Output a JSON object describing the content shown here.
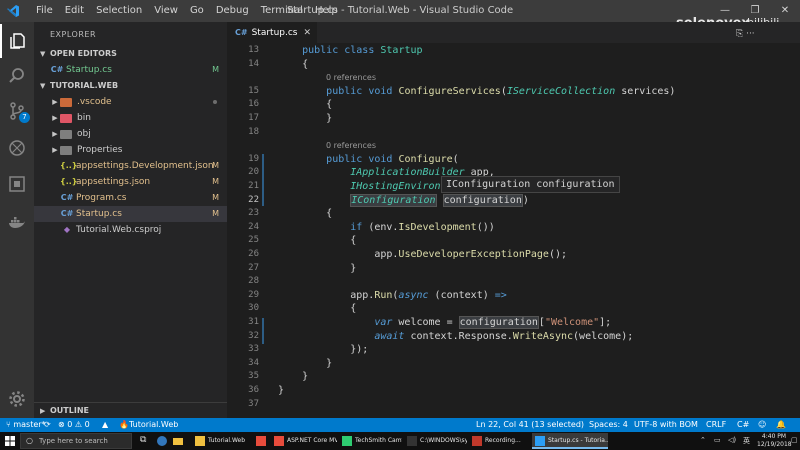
{
  "titlebar": {
    "menu": [
      "File",
      "Edit",
      "Selection",
      "View",
      "Go",
      "Debug",
      "Terminal",
      "Help"
    ],
    "window_title": "Startup.cs - Tutorial.Web - Visual Studio Code",
    "controls": [
      "—",
      "❐",
      "✕"
    ]
  },
  "watermark": {
    "text": "solenovex",
    "sub": "bilibili"
  },
  "activitybar": {
    "icons": [
      "files-icon",
      "search-icon",
      "source-control-icon",
      "debug-icon",
      "extensions-icon",
      "docker-icon",
      "settings-gear-icon"
    ],
    "scm_badge": "7"
  },
  "sidebar": {
    "title": "EXPLORER",
    "open_editors_header": "OPEN EDITORS",
    "open_editors": [
      {
        "icon": "C#",
        "label": "Startup.cs",
        "decor": "M"
      }
    ],
    "project_header": "TUTORIAL.WEB",
    "tree": [
      {
        "kind": "folder",
        "label": ".vscode",
        "color": "#cb6a3a",
        "decor": "dot"
      },
      {
        "kind": "folder",
        "label": "bin",
        "color": "#e05666",
        "decor": ""
      },
      {
        "kind": "folder",
        "label": "obj",
        "color": "#7e7e7e",
        "decor": ""
      },
      {
        "kind": "folder",
        "label": "Properties",
        "color": "#7e7e7e",
        "decor": ""
      },
      {
        "kind": "json",
        "label": "appsettings.Development.json",
        "icon": "{..}",
        "decor": "M"
      },
      {
        "kind": "json",
        "label": "appsettings.json",
        "icon": "{..}",
        "decor": "M"
      },
      {
        "kind": "cs",
        "label": "Program.cs",
        "icon": "C#",
        "decor": "M"
      },
      {
        "kind": "cs",
        "label": "Startup.cs",
        "icon": "C#",
        "decor": "M"
      },
      {
        "kind": "proj",
        "label": "Tutorial.Web.csproj",
        "icon": "◆",
        "decor": ""
      }
    ],
    "outline_header": "OUTLINE"
  },
  "tab": {
    "icon": "C#",
    "label": "Startup.cs",
    "close": "✕"
  },
  "editor": {
    "references_label": "0 references",
    "hover_text": "IConfiguration configuration",
    "lines": [
      {
        "n": "13",
        "tokens": [
          [
            "    ",
            ""
          ],
          [
            "public",
            "kw"
          ],
          [
            " ",
            ""
          ],
          [
            "class",
            "kw"
          ],
          [
            " ",
            ""
          ],
          [
            "Startup",
            "ty"
          ]
        ]
      },
      {
        "n": "14",
        "tokens": [
          [
            "    {",
            ""
          ]
        ]
      },
      {
        "n": "15",
        "tokens": [
          [
            "        ",
            ""
          ],
          [
            "public",
            "kw"
          ],
          [
            " ",
            ""
          ],
          [
            "void",
            "kw"
          ],
          [
            " ",
            ""
          ],
          [
            "ConfigureServices",
            "fn"
          ],
          [
            "(",
            ""
          ],
          [
            "IServiceCollection",
            "ti"
          ],
          [
            " services)",
            ""
          ]
        ]
      },
      {
        "n": "16",
        "tokens": [
          [
            "        {",
            ""
          ]
        ]
      },
      {
        "n": "17",
        "tokens": [
          [
            "        }",
            ""
          ]
        ]
      },
      {
        "n": "18",
        "tokens": [
          [
            "",
            ""
          ]
        ]
      },
      {
        "n": "19",
        "tokens": [
          [
            "        ",
            ""
          ],
          [
            "public",
            "kw"
          ],
          [
            " ",
            ""
          ],
          [
            "void",
            "kw"
          ],
          [
            " ",
            ""
          ],
          [
            "Configure",
            "fn"
          ],
          [
            "(",
            ""
          ]
        ]
      },
      {
        "n": "20",
        "tokens": [
          [
            "            ",
            ""
          ],
          [
            "IApplicationBuilder",
            "ti"
          ],
          [
            " app,",
            ""
          ]
        ]
      },
      {
        "n": "21",
        "tokens": [
          [
            "            ",
            ""
          ],
          [
            "IHostingEnviron",
            "ti"
          ]
        ]
      },
      {
        "n": "22",
        "tokens": [
          [
            "            ",
            ""
          ],
          [
            "IConfiguration",
            "ti hl2"
          ],
          [
            " ",
            ""
          ],
          [
            "configuration",
            "hl2"
          ],
          [
            ")",
            ""
          ]
        ]
      },
      {
        "n": "23",
        "tokens": [
          [
            "        {",
            ""
          ]
        ]
      },
      {
        "n": "24",
        "tokens": [
          [
            "            ",
            ""
          ],
          [
            "if",
            "kw"
          ],
          [
            " (env.",
            ""
          ],
          [
            "IsDevelopment",
            "fn"
          ],
          [
            "())",
            ""
          ]
        ]
      },
      {
        "n": "25",
        "tokens": [
          [
            "            {",
            ""
          ]
        ]
      },
      {
        "n": "26",
        "tokens": [
          [
            "                app.",
            ""
          ],
          [
            "UseDeveloperExceptionPage",
            "fn"
          ],
          [
            "();",
            ""
          ]
        ]
      },
      {
        "n": "27",
        "tokens": [
          [
            "            }",
            ""
          ]
        ]
      },
      {
        "n": "28",
        "tokens": [
          [
            "",
            ""
          ]
        ]
      },
      {
        "n": "29",
        "tokens": [
          [
            "            app.",
            ""
          ],
          [
            "Run",
            "fn"
          ],
          [
            "(",
            ""
          ],
          [
            "async",
            "ki"
          ],
          [
            " (context) ",
            ""
          ],
          [
            "=>",
            "kw"
          ]
        ]
      },
      {
        "n": "30",
        "tokens": [
          [
            "            {",
            ""
          ]
        ]
      },
      {
        "n": "31",
        "tokens": [
          [
            "                ",
            ""
          ],
          [
            "var",
            "ki"
          ],
          [
            " welcome ",
            ""
          ],
          [
            "=",
            ""
          ],
          [
            " ",
            ""
          ],
          [
            "configuration",
            "hl2"
          ],
          [
            "[",
            ""
          ],
          [
            "\"Welcome\"",
            "st"
          ],
          [
            "];",
            ""
          ]
        ]
      },
      {
        "n": "32",
        "tokens": [
          [
            "                ",
            ""
          ],
          [
            "await",
            "ki"
          ],
          [
            " context.Response.",
            ""
          ],
          [
            "WriteAsync",
            "fn"
          ],
          [
            "(welcome);",
            ""
          ]
        ]
      },
      {
        "n": "33",
        "tokens": [
          [
            "            });",
            ""
          ]
        ]
      },
      {
        "n": "34",
        "tokens": [
          [
            "        }",
            ""
          ]
        ]
      },
      {
        "n": "35",
        "tokens": [
          [
            "    }",
            ""
          ]
        ]
      },
      {
        "n": "36",
        "tokens": [
          [
            "}",
            ""
          ]
        ]
      },
      {
        "n": "37",
        "tokens": [
          [
            "",
            ""
          ]
        ]
      }
    ],
    "active_line": "22"
  },
  "statusbar": {
    "branch": "master*",
    "sync": "⟳",
    "errors": "0",
    "warnings": "0",
    "project": "Tutorial.Web",
    "position": "Ln 22, Col 41 (13 selected)",
    "spaces": "Spaces: 4",
    "encoding": "UTF-8 with BOM",
    "eol": "CRLF",
    "language": "C#"
  },
  "taskbar": {
    "search_placeholder": "Type here to search",
    "apps": [
      {
        "label": "Tutorial.Web",
        "color": "#f0c040"
      },
      {
        "label": "",
        "color": "#e74c3c"
      },
      {
        "label": "ASP.NET Core MVC...",
        "color": "#e74c3c"
      },
      {
        "label": "TechSmith Camtasi...",
        "color": "#2ecc71"
      },
      {
        "label": "C:\\WINDOWS\\syst...",
        "color": "#333333"
      },
      {
        "label": "Recording...",
        "color": "#c0392b"
      },
      {
        "label": "Startup.cs - Tutoria...",
        "color": "#2b9ef5"
      }
    ],
    "time": "4:40 PM",
    "date": "12/19/2018"
  }
}
